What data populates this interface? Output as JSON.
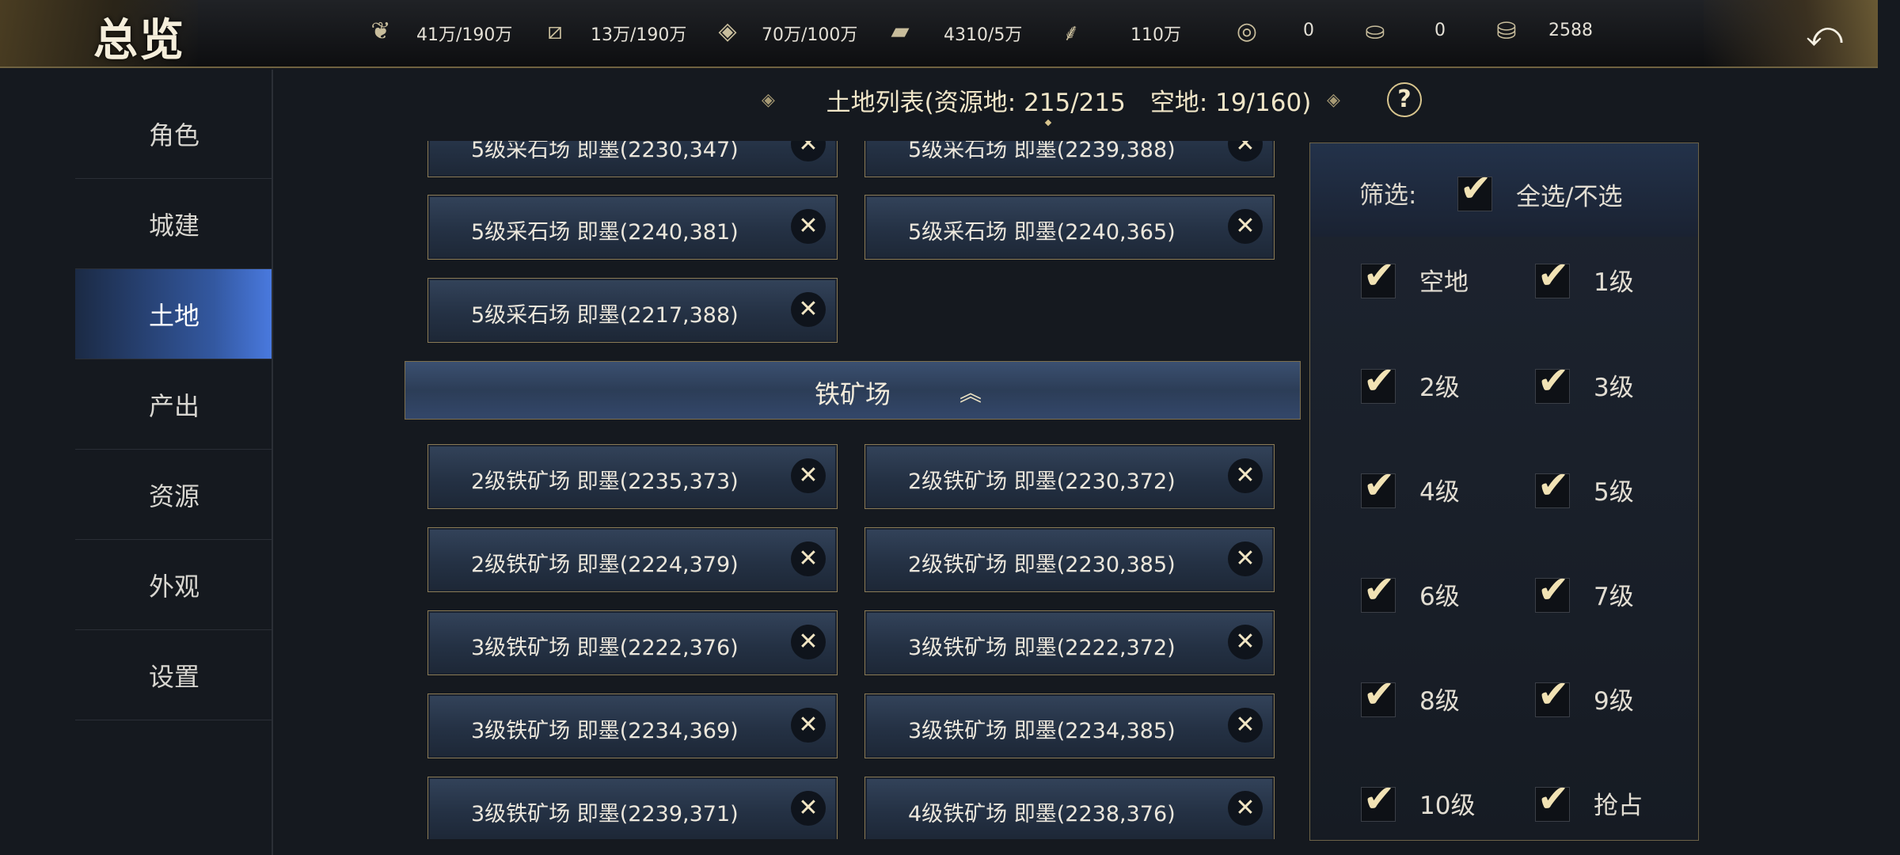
{
  "header": {
    "title": "总览",
    "resources": [
      {
        "icon": "grain-icon",
        "value": "41万/190万"
      },
      {
        "icon": "wood-icon",
        "value": "13万/190万"
      },
      {
        "icon": "stone-icon",
        "value": "70万/100万"
      },
      {
        "icon": "iron-icon",
        "value": "4310/5万"
      },
      {
        "icon": "decree-icon",
        "value": "110万"
      },
      {
        "icon": "coin-icon",
        "value": "0"
      },
      {
        "icon": "gold-ingot-icon",
        "value": "0"
      },
      {
        "icon": "silver-ingot-icon",
        "value": "2588"
      }
    ]
  },
  "sidebar": {
    "items": [
      {
        "label": "角色",
        "active": false
      },
      {
        "label": "城建",
        "active": false
      },
      {
        "label": "土地",
        "active": true
      },
      {
        "label": "产出",
        "active": false
      },
      {
        "label": "资源",
        "active": false
      },
      {
        "label": "外观",
        "active": false
      },
      {
        "label": "设置",
        "active": false
      }
    ]
  },
  "list": {
    "title": "土地列表(资源地: 215/215　空地: 19/160)",
    "help": "?",
    "stone_items": [
      "5级采石场 即墨(2230,347)",
      "5级采石场 即墨(2239,388)",
      "5级采石场 即墨(2240,381)",
      "5级采石场 即墨(2240,365)",
      "5级采石场 即墨(2217,388)"
    ],
    "iron_section": "铁矿场",
    "iron_items": [
      "2级铁矿场 即墨(2235,373)",
      "2级铁矿场 即墨(2230,372)",
      "2级铁矿场 即墨(2224,379)",
      "2级铁矿场 即墨(2230,385)",
      "3级铁矿场 即墨(2222,376)",
      "3级铁矿场 即墨(2222,372)",
      "3级铁矿场 即墨(2234,369)",
      "3级铁矿场 即墨(2234,385)",
      "3级铁矿场 即墨(2239,371)",
      "4级铁矿场 即墨(2238,376)"
    ],
    "remove_symbol": "✕"
  },
  "filter": {
    "label": "筛选:",
    "select_all": "全选/不选",
    "select_all_checked": true,
    "options": [
      {
        "label": "空地",
        "checked": true
      },
      {
        "label": "1级",
        "checked": true
      },
      {
        "label": "2级",
        "checked": true
      },
      {
        "label": "3级",
        "checked": true
      },
      {
        "label": "4级",
        "checked": true
      },
      {
        "label": "5级",
        "checked": true
      },
      {
        "label": "6级",
        "checked": true
      },
      {
        "label": "7级",
        "checked": true
      },
      {
        "label": "8级",
        "checked": true
      },
      {
        "label": "9级",
        "checked": true
      },
      {
        "label": "10级",
        "checked": true
      },
      {
        "label": "抢占",
        "checked": true
      }
    ],
    "check_symbol": "✔"
  }
}
